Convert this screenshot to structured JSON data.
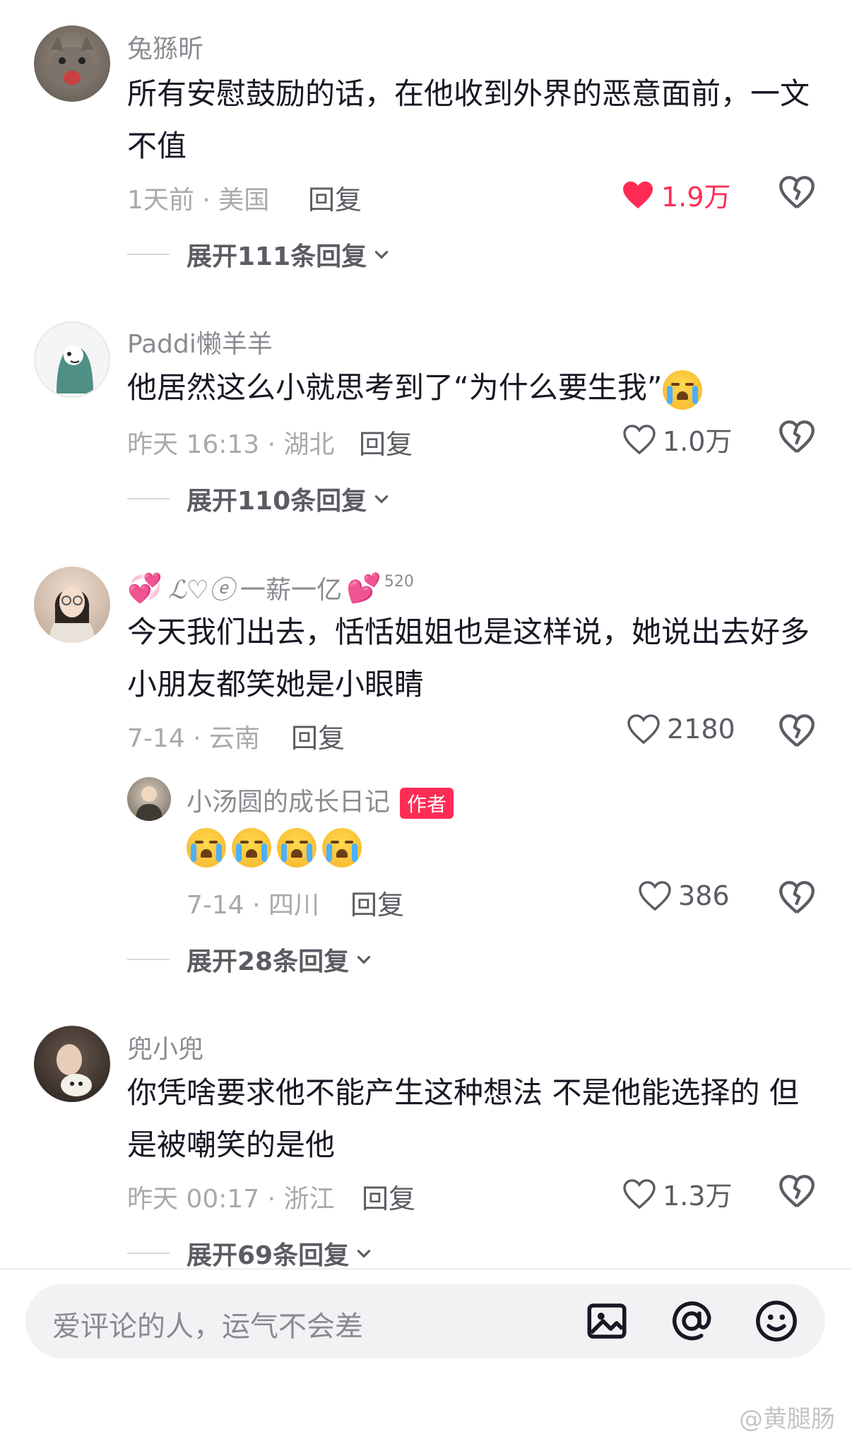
{
  "comments": [
    {
      "username": "兔猻昕",
      "text": "所有安慰鼓励的话，在他收到外界的恶意面前，一文不值",
      "time_location": "1天前 · 美国",
      "reply_label": "回复",
      "likes": "1.9万",
      "liked": true,
      "expand_label": "展开111条回复"
    },
    {
      "username": "Paddi懒羊羊",
      "text": "他居然这么小就思考到了“为什么要生我”",
      "time_location": "昨天 16:13 · 湖北",
      "reply_label": "回复",
      "likes": "1.0万",
      "liked": false,
      "expand_label": "展开110条回复"
    },
    {
      "username": "一薪一亿",
      "username_badge": "520",
      "text": "今天我们出去，恬恬姐姐也是这样说，她说出去好多小朋友都笑她是小眼睛",
      "time_location": "7-14 · 云南",
      "reply_label": "回复",
      "likes": "2180",
      "liked": false,
      "sub_reply": {
        "username": "小汤圆的成长日记",
        "author_badge": "作者",
        "time_location": "7-14 · 四川",
        "reply_label": "回复",
        "likes": "386"
      },
      "expand_label": "展开28条回复"
    },
    {
      "username": "兜小兜",
      "text": "你凭啥要求他不能产生这种想法 不是他能选择的 但是被嘲笑的是他",
      "time_location": "昨天 00:17 · 浙江",
      "reply_label": "回复",
      "likes": "1.3万",
      "liked": false,
      "expand_label": "展开69条回复"
    }
  ],
  "input": {
    "placeholder": "爱评论的人，运气不会差"
  },
  "watermark": "@黄腿肠",
  "colors": {
    "accent_red": "#fe2c55",
    "text_primary": "#161823",
    "text_secondary": "#8a8b91"
  }
}
